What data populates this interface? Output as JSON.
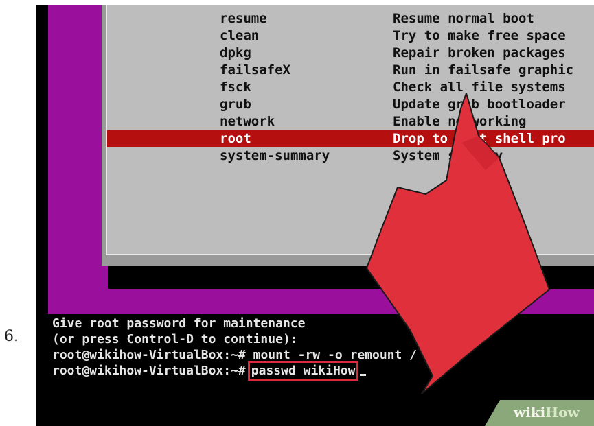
{
  "step_number": "6.",
  "menu": {
    "items": [
      {
        "name": "resume",
        "description": "Resume normal boot"
      },
      {
        "name": "clean",
        "description": "Try to make free space"
      },
      {
        "name": "dpkg",
        "description": "Repair broken packages"
      },
      {
        "name": "failsafeX",
        "description": "Run in failsafe graphic"
      },
      {
        "name": "fsck",
        "description": "Check all file systems"
      },
      {
        "name": "grub",
        "description": "Update grub bootloader"
      },
      {
        "name": "network",
        "description": "Enable networking"
      },
      {
        "name": "root",
        "description": "Drop to root shell pro",
        "selected": true
      },
      {
        "name": "system-summary",
        "description": "System summary"
      }
    ]
  },
  "terminal": {
    "line1": "Give root password for maintenance",
    "line2": "(or press Control-D to continue):",
    "prompt": "root@wikihow-VirtualBox:~#",
    "command1": "mount -rw -o remount /",
    "command2": "passwd wikiHow"
  },
  "watermark": {
    "part1": "wiki",
    "part2": "How"
  },
  "colors": {
    "magenta_background": "#9a0f9b",
    "menu_panel": "#bdbdbd",
    "selection": "#b50f0f",
    "arrow": "#e0303c",
    "highlight_box": "#dd2a3a"
  },
  "icons": {
    "pointer": "down-arrow-icon"
  }
}
